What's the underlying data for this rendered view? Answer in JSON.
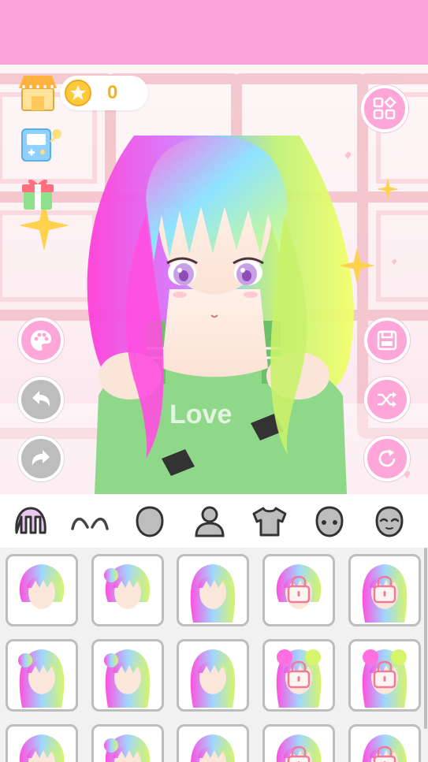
{
  "header": {
    "coins": "0"
  },
  "left_toolbar": [
    {
      "name": "shop-icon"
    },
    {
      "name": "game-console-icon"
    },
    {
      "name": "gift-icon"
    }
  ],
  "actions": {
    "left": [
      "palette-icon",
      "undo-icon",
      "redo-icon"
    ],
    "right": [
      "save-icon",
      "shuffle-icon",
      "reset-icon"
    ],
    "top_right": "categories-grid-icon"
  },
  "categories": [
    {
      "id": "hair",
      "icon": "hair-icon",
      "selected": true
    },
    {
      "id": "eyebrows",
      "icon": "eyebrows-icon"
    },
    {
      "id": "head",
      "icon": "head-icon"
    },
    {
      "id": "body",
      "icon": "body-icon"
    },
    {
      "id": "clothes",
      "icon": "shirt-icon"
    },
    {
      "id": "face",
      "icon": "face-icon"
    },
    {
      "id": "expression",
      "icon": "expression-icon"
    }
  ],
  "hair_items": [
    {
      "locked": false
    },
    {
      "locked": false
    },
    {
      "locked": false
    },
    {
      "locked": true
    },
    {
      "locked": true
    },
    {
      "locked": false
    },
    {
      "locked": false
    },
    {
      "locked": false
    },
    {
      "locked": true
    },
    {
      "locked": true
    },
    {
      "locked": false
    },
    {
      "locked": false
    },
    {
      "locked": false
    },
    {
      "locked": true
    },
    {
      "locked": true
    }
  ],
  "colors": {
    "top_bar": "#ffa3dd",
    "button_pink": "#ffa6d8",
    "button_gray": "#bdbdbd",
    "coin": "#f2b31f",
    "shirt": "#8fd889",
    "hair_gradient": [
      "#ff4fe0",
      "#8fb7ff",
      "#c7f277",
      "#f4ff6a"
    ]
  }
}
